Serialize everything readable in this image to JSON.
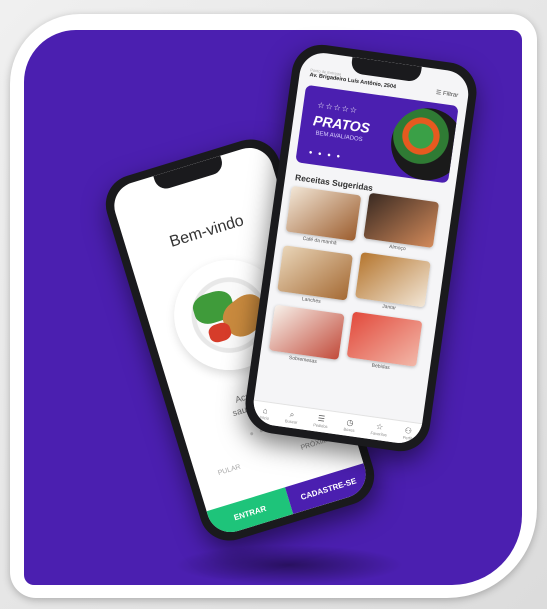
{
  "left_phone": {
    "welcome_title": "Bem-vindo",
    "description_line1": "Acreditamos",
    "description_line2": "saudável e sa...",
    "pager_dots": "● ● ● ●",
    "skip_label": "PULAR",
    "next_label": "PRÓXIMO ›",
    "enter_button": "ENTRAR",
    "signup_button": "CADASTRE-SE"
  },
  "right_phone": {
    "address_hint": "Ponto de Entrega",
    "address": "Av. Brigadeiro Luís Antônio, 2504",
    "filter_label": "Filtrar",
    "banner": {
      "stars": "☆☆☆☆☆",
      "title": "PRATOS",
      "subtitle": "BEM AVALIADOS",
      "dots": "● ● ● ●"
    },
    "section_title": "Receitas Sugeridas",
    "recipes": [
      {
        "label": "Café da manhã"
      },
      {
        "label": "Almoço"
      },
      {
        "label": "Lanches"
      },
      {
        "label": "Jantar"
      },
      {
        "label": "Sobremesas"
      },
      {
        "label": "Bebidas"
      }
    ],
    "nav": [
      {
        "icon": "home-icon",
        "glyph": "⌂",
        "label": "Início"
      },
      {
        "icon": "search-icon",
        "glyph": "⌕",
        "label": "Buscar"
      },
      {
        "icon": "list-icon",
        "glyph": "☰",
        "label": "Pedidos"
      },
      {
        "icon": "clock-icon",
        "glyph": "◷",
        "label": "Boxes"
      },
      {
        "icon": "star-icon",
        "glyph": "☆",
        "label": "Favoritos"
      },
      {
        "icon": "user-icon",
        "glyph": "⚇",
        "label": "Perfil"
      }
    ]
  },
  "colors": {
    "brand_purple": "#4b1fb0",
    "enter_green": "#1ec47a"
  }
}
